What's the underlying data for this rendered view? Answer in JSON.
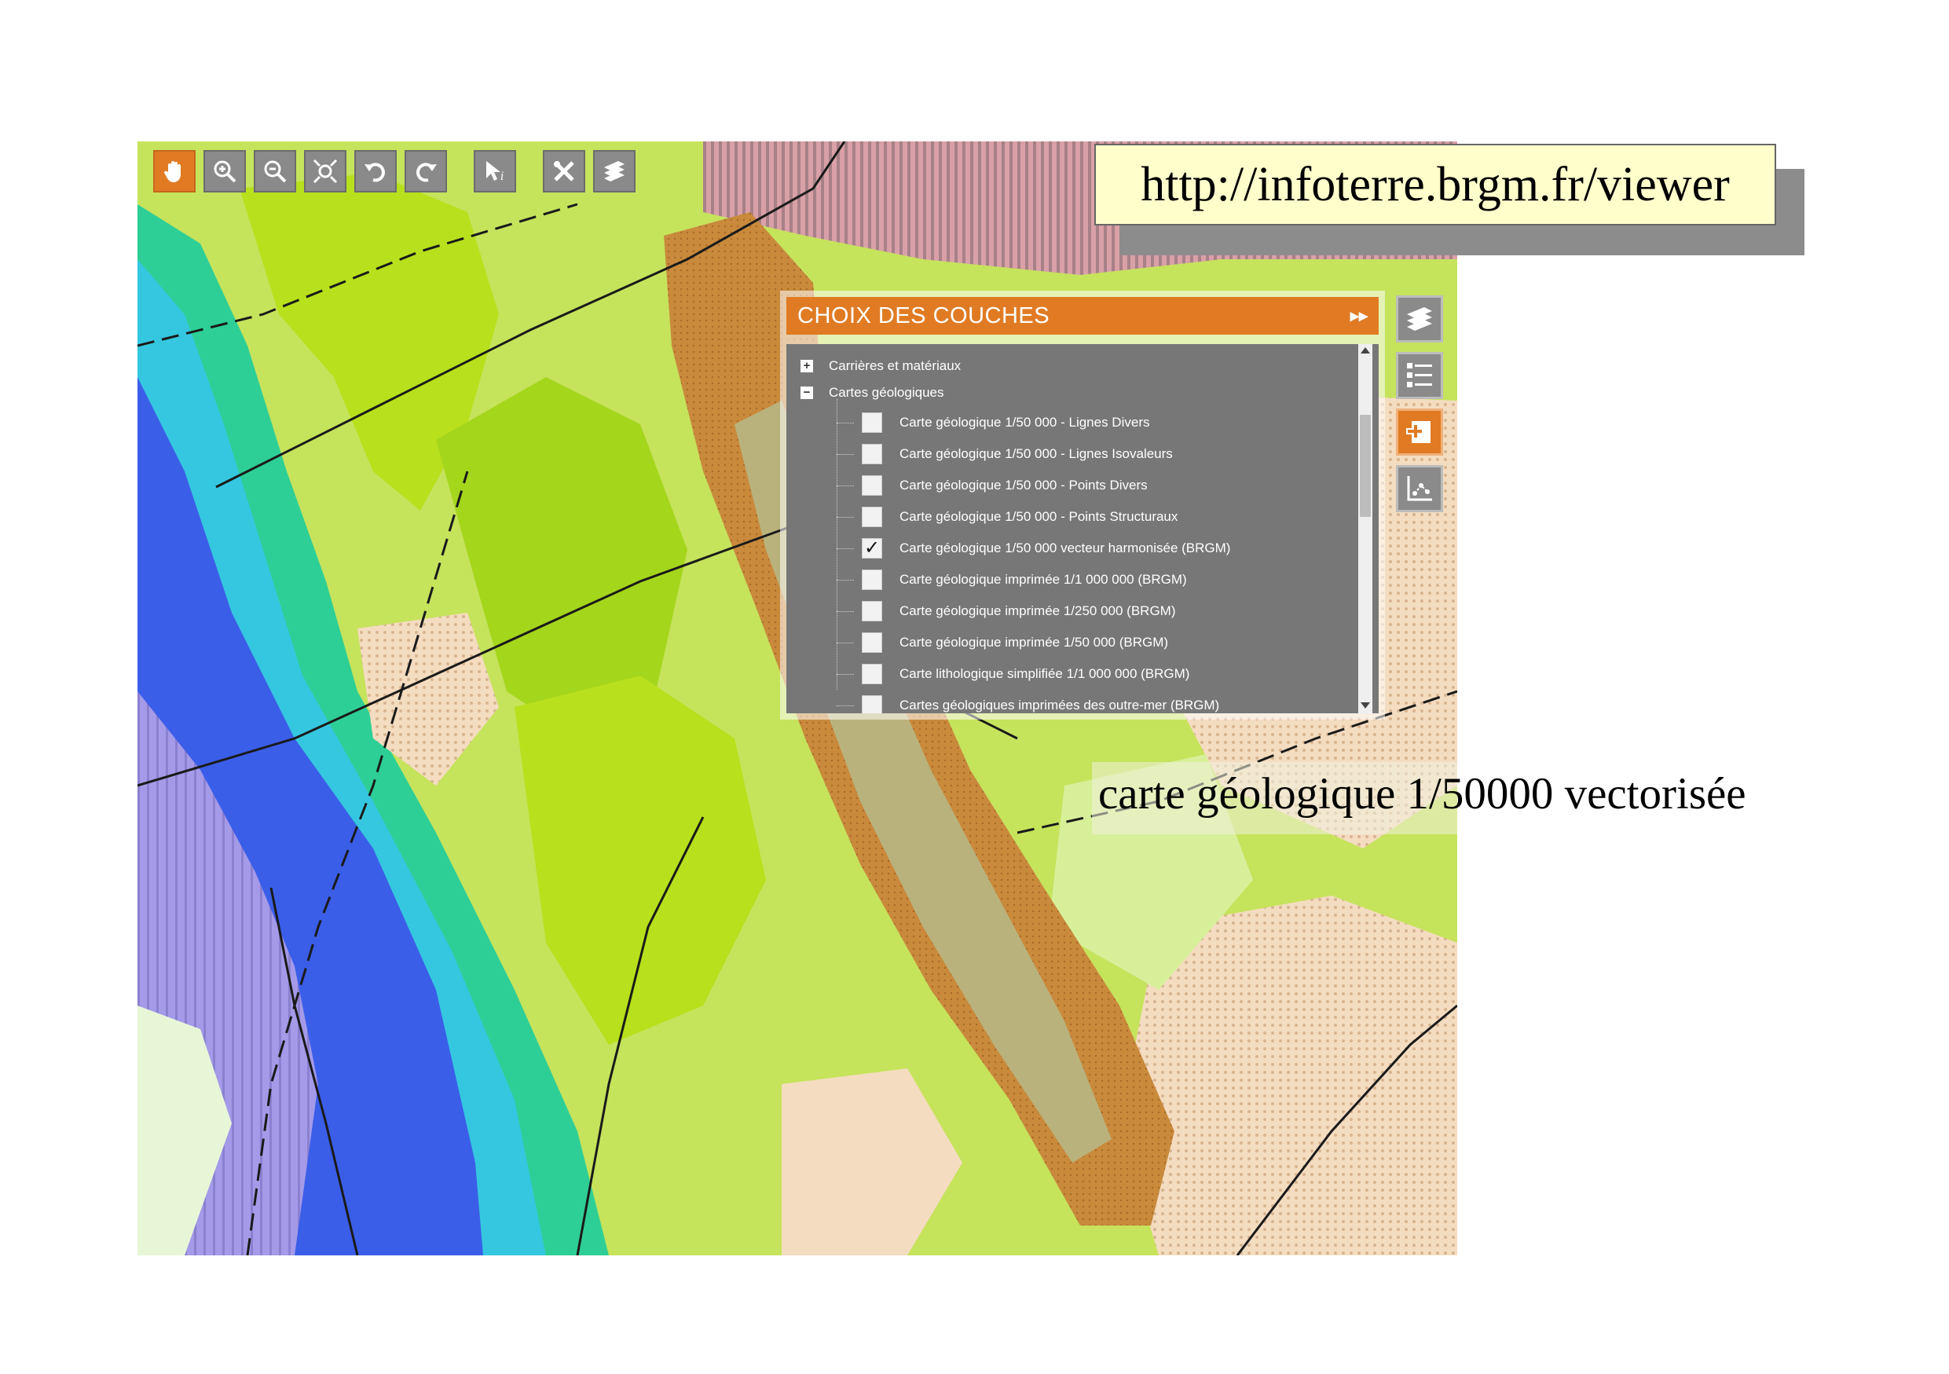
{
  "toolbar": {
    "tools": [
      {
        "name": "pan-hand-icon",
        "active": true
      },
      {
        "name": "zoom-in-icon",
        "active": false
      },
      {
        "name": "zoom-out-icon",
        "active": false
      },
      {
        "name": "zoom-extent-icon",
        "active": false
      },
      {
        "name": "undo-icon",
        "active": false
      },
      {
        "name": "redo-icon",
        "active": false
      },
      {
        "name": "info-pointer-icon",
        "active": false
      },
      {
        "name": "tools-icon",
        "active": false
      },
      {
        "name": "layers-icon",
        "active": false
      }
    ]
  },
  "layer_panel": {
    "title": "CHOIX DES COUCHES",
    "collapse_glyph": "▸▸",
    "groups": [
      {
        "label": "Carrières et matériaux",
        "expanded": false,
        "toggle": "+"
      },
      {
        "label": "Cartes géologiques",
        "expanded": true,
        "toggle": "−"
      }
    ],
    "layers": [
      {
        "label": "Carte géologique 1/50 000 - Lignes Divers",
        "checked": false
      },
      {
        "label": "Carte géologique 1/50 000 - Lignes Isovaleurs",
        "checked": false
      },
      {
        "label": "Carte géologique 1/50 000 - Points Divers",
        "checked": false
      },
      {
        "label": "Carte géologique 1/50 000 - Points Structuraux",
        "checked": false
      },
      {
        "label": "Carte géologique 1/50 000 vecteur harmonisée (BRGM)",
        "checked": true
      },
      {
        "label": "Carte géologique imprimée 1/1 000 000 (BRGM)",
        "checked": false
      },
      {
        "label": "Carte géologique imprimée 1/250 000 (BRGM)",
        "checked": false
      },
      {
        "label": "Carte géologique imprimée 1/50 000 (BRGM)",
        "checked": false
      },
      {
        "label": "Carte lithologique simplifiée 1/1 000 000 (BRGM)",
        "checked": false
      },
      {
        "label": "Cartes géologiques imprimées des outre-mer (BRGM)",
        "checked": false
      }
    ],
    "check_glyph": "✓"
  },
  "side_tools": [
    {
      "name": "layers-stack-icon",
      "active": false
    },
    {
      "name": "legend-list-icon",
      "active": false
    },
    {
      "name": "add-layer-icon",
      "active": true
    },
    {
      "name": "measure-icon",
      "active": false
    }
  ],
  "captions": {
    "url": "http://infoterre.brgm.fr/viewer",
    "map_caption": "carte géologique 1/50000 vectorisée"
  },
  "colors": {
    "accent": "#e07b24",
    "panel_gray": "#777777",
    "url_box": "#ffffcc"
  }
}
